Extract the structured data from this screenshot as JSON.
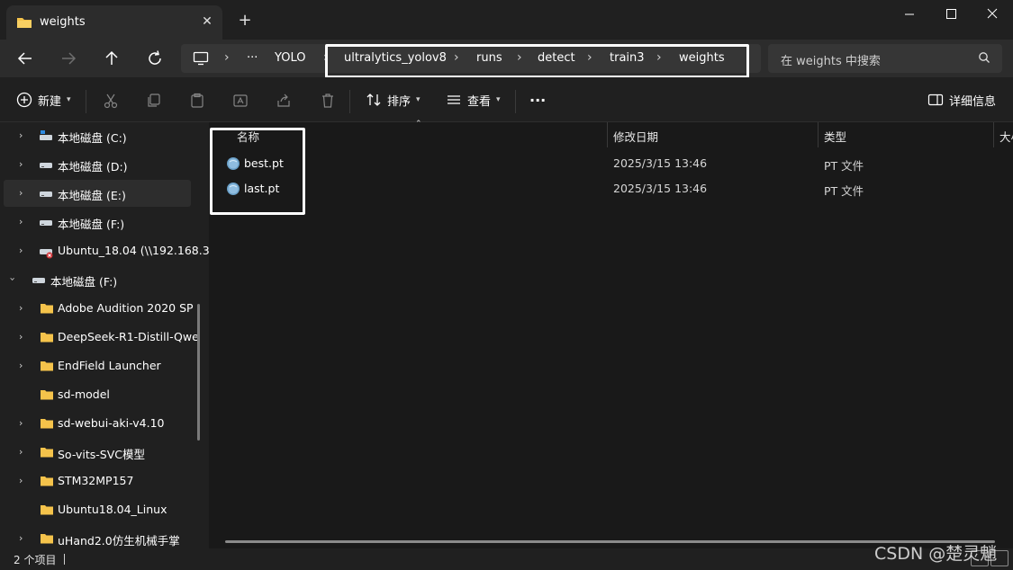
{
  "window": {
    "tab_title": "weights",
    "tab_close": "✕",
    "new_tab": "+"
  },
  "address_bar": {
    "overflow": "···",
    "crumbs": [
      "YOLO",
      "ultralytics_yolov8",
      "runs",
      "detect",
      "train3",
      "weights"
    ],
    "separator": "›"
  },
  "search": {
    "placeholder": "在 weights 中搜索"
  },
  "toolbar": {
    "new_label": "新建",
    "sort_label": "排序",
    "view_label": "查看",
    "more_label": "···",
    "details_label": "详细信息"
  },
  "sidebar": {
    "items": [
      {
        "label": "本地磁盘 (C:)"
      },
      {
        "label": "本地磁盘 (D:)"
      },
      {
        "label": "本地磁盘 (E:)"
      },
      {
        "label": "本地磁盘 (F:)"
      },
      {
        "label": "Ubuntu_18.04 (\\\\192.168.3"
      },
      {
        "label": "本地磁盘 (F:)"
      },
      {
        "label": "Adobe Audition 2020 SP"
      },
      {
        "label": "DeepSeek-R1-Distill-Qwe"
      },
      {
        "label": "EndField Launcher"
      },
      {
        "label": "sd-model"
      },
      {
        "label": "sd-webui-aki-v4.10"
      },
      {
        "label": "So-vits-SVC模型"
      },
      {
        "label": "STM32MP157"
      },
      {
        "label": "Ubuntu18.04_Linux"
      },
      {
        "label": "uHand2.0仿生机械手掌"
      }
    ]
  },
  "columns": {
    "name": "名称",
    "modified": "修改日期",
    "type": "类型",
    "size": "大小"
  },
  "files": [
    {
      "name": "best.pt",
      "modified": "2025/3/15 13:46",
      "type": "PT 文件"
    },
    {
      "name": "last.pt",
      "modified": "2025/3/15 13:46",
      "type": "PT 文件"
    }
  ],
  "status": {
    "count": "2 个项目"
  },
  "watermark": "CSDN @楚灵魈",
  "colors": {
    "background": "#191919",
    "panel": "#202020",
    "folder": "#f5c34b",
    "highlight_border": "#ffffff"
  }
}
